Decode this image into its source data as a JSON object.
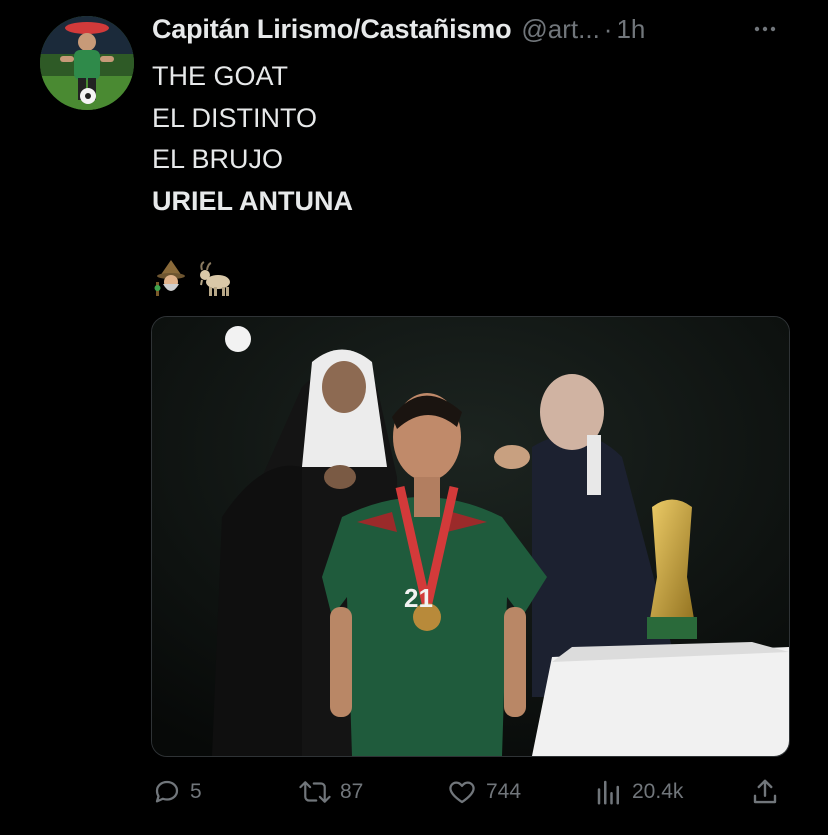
{
  "tweet": {
    "display_name": "Capitán Lirismo/Castañismo",
    "handle": "@art...",
    "separator": "·",
    "time": "1h",
    "lines": [
      "THE GOAT",
      "EL DISTINTO",
      "EL BRUJO",
      "URIEL ANTUNA"
    ],
    "emojis": [
      "mage-emoji",
      "goat-emoji"
    ]
  },
  "actions": {
    "replies": "5",
    "retweets": "87",
    "likes": "744",
    "views": "20.4k"
  },
  "colors": {
    "background": "#000000",
    "text": "#e7e9ea",
    "muted": "#71767b",
    "jersey_green": "#1f5b3c",
    "jersey_red": "#9b2a2a",
    "trophy_gold": "#c9a23a"
  }
}
